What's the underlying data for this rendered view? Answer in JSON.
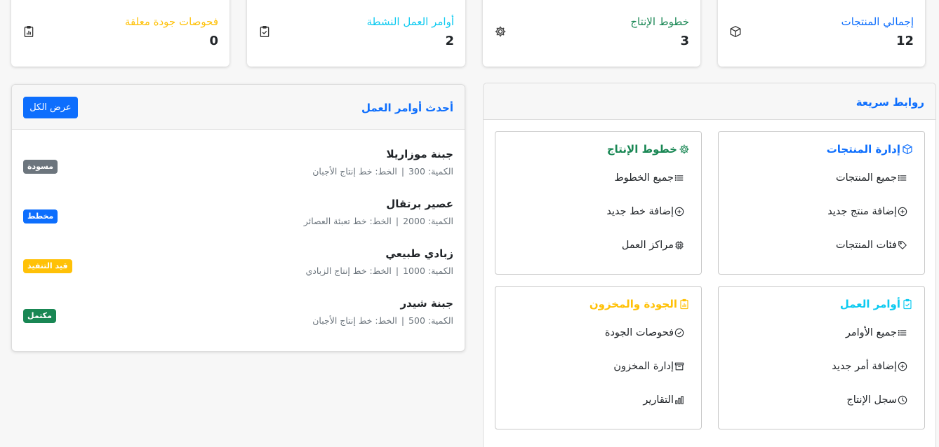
{
  "colors": {
    "primary": "#0d6efd",
    "success": "#198754",
    "info": "#0dcaf0",
    "warning": "#ffc107",
    "secondary": "#6c757d"
  },
  "stats": [
    {
      "title": "إجمالي المنتجات",
      "value": "12",
      "icon": "box-icon",
      "color": "#0d6efd"
    },
    {
      "title": "خطوط الإنتاج",
      "value": "3",
      "icon": "gear-icon",
      "color": "#198754"
    },
    {
      "title": "أوامر العمل النشطة",
      "value": "2",
      "icon": "clipboard-check-icon",
      "color": "#0dcaf0"
    },
    {
      "title": "فحوصات جودة معلقة",
      "value": "0",
      "icon": "clipboard-data-icon",
      "color": "#ffc107"
    }
  ],
  "orders_panel": {
    "title": "أحدث أوامر العمل",
    "view_all_label": "عرض الكل",
    "quantity_label": "الكمية:",
    "line_label": "الخط:",
    "separator": "|",
    "orders": [
      {
        "name": "جبنة موزاريلا",
        "quantity": "300",
        "line": "خط إنتاج الأجبان",
        "status": "مسودة",
        "status_color": "#6c757d"
      },
      {
        "name": "عصير برتقال",
        "quantity": "2000",
        "line": "خط تعبئة العصائر",
        "status": "مخطط",
        "status_color": "#0d6efd"
      },
      {
        "name": "زبادي طبيعي",
        "quantity": "1000",
        "line": "خط إنتاج الزبادي",
        "status": "قيد التنفيذ",
        "status_color": "#ffc107"
      },
      {
        "name": "جبنة شيدر",
        "quantity": "500",
        "line": "خط إنتاج الأجبان",
        "status": "مكتمل",
        "status_color": "#198754"
      }
    ]
  },
  "links_panel": {
    "title": "روابط سريعة",
    "groups": [
      {
        "title": "إدارة المنتجات",
        "icon": "box-icon",
        "color": "#0d6efd",
        "items": [
          {
            "label": "جميع المنتجات",
            "icon": "list-icon"
          },
          {
            "label": "إضافة منتج جديد",
            "icon": "plus-circle-icon"
          },
          {
            "label": "فئات المنتجات",
            "icon": "tag-icon"
          }
        ]
      },
      {
        "title": "خطوط الإنتاج",
        "icon": "gear-icon",
        "color": "#198754",
        "items": [
          {
            "label": "جميع الخطوط",
            "icon": "list-icon"
          },
          {
            "label": "إضافة خط جديد",
            "icon": "plus-circle-icon"
          },
          {
            "label": "مراكز العمل",
            "icon": "cpu-icon"
          }
        ]
      },
      {
        "title": "أوامر العمل",
        "icon": "clipboard-check-icon",
        "color": "#0dcaf0",
        "items": [
          {
            "label": "جميع الأوامر",
            "icon": "list-icon"
          },
          {
            "label": "إضافة أمر جديد",
            "icon": "plus-circle-icon"
          },
          {
            "label": "سجل الإنتاج",
            "icon": "clock-icon"
          }
        ]
      },
      {
        "title": "الجودة والمخزون",
        "icon": "clipboard-data-icon",
        "color": "#ffc107",
        "items": [
          {
            "label": "فحوصات الجودة",
            "icon": "check-circle-icon"
          },
          {
            "label": "إدارة المخزون",
            "icon": "archive-icon"
          },
          {
            "label": "التقارير",
            "icon": "bar-chart-icon"
          }
        ]
      }
    ]
  }
}
